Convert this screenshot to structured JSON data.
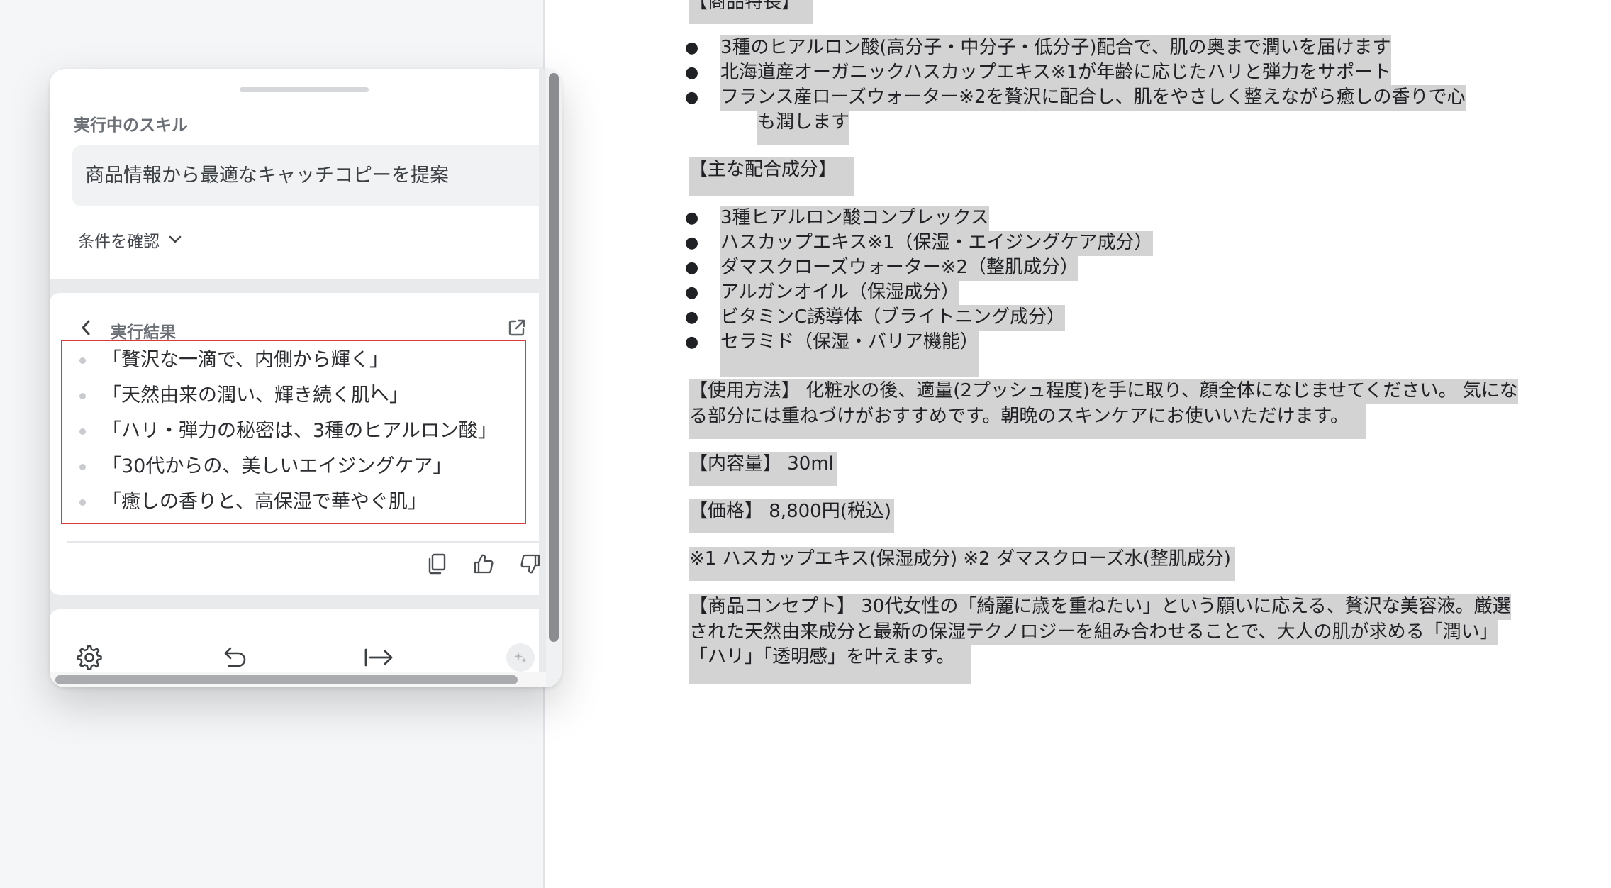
{
  "panel": {
    "skill_section_label": "実行中のスキル",
    "skill_name": "商品情報から最適なキャッチコピーを提案",
    "conditions_label": "条件を確認",
    "result_title": "実行結果",
    "results": [
      "「贅沢な一滴で、内側から輝く」",
      "「天然由来の潤い、輝き続く肌へ」",
      "「ハリ・弾力の秘密は、3種のヒアルロン酸」",
      "「30代からの、美しいエイジングケア」",
      "「癒しの香りと、高保湿で華やぐ肌」"
    ],
    "text_cursor_glyph": "I"
  },
  "document": {
    "features_heading": "【商品特長】",
    "features": [
      "3種のヒアルロン酸(高分子・中分子・低分子)配合で、肌の奥まで潤いを届けます",
      "北海道産オーガニックハスカップエキス※1が年齢に応じたハリと弾力をサポート",
      "フランス産ローズウォーター※2を贅沢に配合し、肌をやさしく整えながら癒しの香りで心",
      "も潤します"
    ],
    "ingredients_heading": "【主な配合成分】",
    "ingredients": [
      "3種ヒアルロン酸コンプレックス",
      "ハスカップエキス※1（保湿・エイジングケア成分）",
      "ダマスクローズウォーター※2（整肌成分）",
      "アルガンオイル（保湿成分）",
      "ビタミンC誘導体（ブライトニング成分）",
      "セラミド（保湿・バリア機能）"
    ],
    "usage_line1": "【使用方法】 化粧水の後、適量(2プッシュ程度)を手に取り、顔全体になじませてください。 気にな",
    "usage_line2": "る部分には重ねづけがおすすめです。朝晩のスキンケアにお使いいただけます。",
    "volume": "【内容量】 30ml",
    "price": "【価格】 8,800円(税込)",
    "notes": "※1 ハスカップエキス(保湿成分) ※2 ダマスクローズ水(整肌成分)",
    "concept_line1": "【商品コンセプト】 30代女性の「綺麗に歳を重ねたい」という願いに応える、贅沢な美容液。厳選",
    "concept_line2": "された天然由来成分と最新の保湿テクノロジーを組み合わせることで、大人の肌が求める「潤い」",
    "concept_line3": "「ハリ」「透明感」を叶えます。"
  },
  "colors": {
    "highlight": "#d3d3d3",
    "result_border": "#d93a3a",
    "panel_background": "#e9eaec"
  },
  "icons": [
    "chevron-down-icon",
    "back-arrow-icon",
    "open-external-icon",
    "close-icon",
    "copy-icon",
    "thumbs-up-icon",
    "thumbs-down-icon",
    "settings-gear-icon",
    "undo-icon",
    "insert-arrow-icon",
    "ai-sparkle-icon"
  ]
}
